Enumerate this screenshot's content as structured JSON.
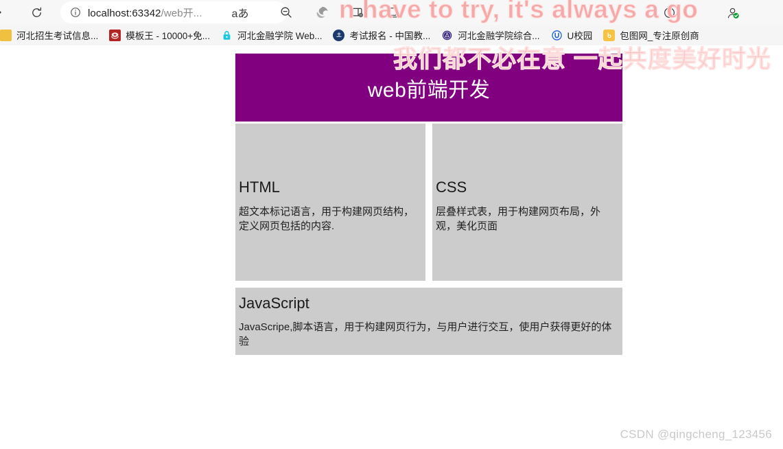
{
  "browser": {
    "toolbar": {
      "forward_icon": "forward-arrow-icon",
      "reload_icon": "reload-icon",
      "info_icon": "info-circle-icon",
      "url_host": "localhost:63342",
      "url_path": "/web开...",
      "url_full": "localhost:63342/web开...",
      "read_aloud_label": "aあ",
      "zoom_out_icon": "zoom-out-icon",
      "edge_refresh_icon": "browser-essentials-icon",
      "split_screen_icon": "split-screen-icon",
      "collections_icon": "collections-icon",
      "history_icon": "history-clock-icon",
      "profile_icon": "profile-verified-icon"
    },
    "bookmarks": [
      {
        "label": "河北招生考试信息...",
        "icon": "hebei-zhaosheng-favicon",
        "color": "#f0c040"
      },
      {
        "label": "模板王 - 10000+免...",
        "icon": "mobanwang-favicon",
        "color": "#b32424"
      },
      {
        "label": "河北金融学院 Web...",
        "icon": "lock-icon",
        "color": "#19c7de"
      },
      {
        "label": "考试报名 - 中国教...",
        "icon": "china-edu-favicon",
        "color": "#1b3a6b"
      },
      {
        "label": "河北金融学院综合...",
        "icon": "hbfu-portal-favicon",
        "color": "#3b2a7a"
      },
      {
        "label": "U校园",
        "icon": "uxiaoyuan-favicon",
        "color": "#1a5fd0"
      },
      {
        "label": "包图网_专注原创商",
        "icon": "baotuwang-favicon",
        "color": "#f5c242"
      }
    ]
  },
  "page": {
    "header": {
      "title": "web前端开发",
      "bg_color": "#800080",
      "text_color": "#ffffff"
    },
    "card_bg_color": "#cccccc",
    "cards": [
      {
        "title": "HTML",
        "text": "超文本标记语言，用于构建网页结构，定义网页包括的内容."
      },
      {
        "title": "CSS",
        "text": "层叠样式表，用于构建网页布局，外观，美化页面"
      },
      {
        "title": "JavaScript",
        "text": "JavaScripe,脚本语言，用于构建网页行为，与用户进行交互，使用户获得更好的体验"
      }
    ]
  },
  "overlay": {
    "line1": "n have to try, it's always a go",
    "line2": "我们都不必在意  一起共度美好时光",
    "color": "#f4a8a8"
  },
  "watermark": {
    "text": "CSDN @qingcheng_123456"
  }
}
